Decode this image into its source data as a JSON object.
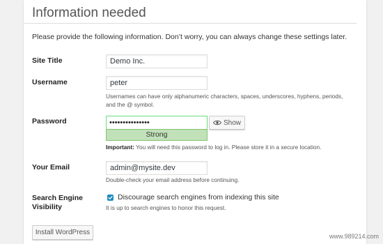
{
  "section": {
    "title": "Information needed",
    "intro": "Please provide the following information. Don’t worry, you can always change these settings later."
  },
  "site_title": {
    "label": "Site Title",
    "value": "Demo Inc."
  },
  "username": {
    "label": "Username",
    "value": "peter",
    "help": "Usernames can have only alphanumeric characters, spaces, underscores, hyphens, periods, and the @ symbol."
  },
  "password": {
    "label": "Password",
    "value": "•••••••••••••••",
    "strength": "Strong",
    "show_label": "Show",
    "note_strong": "Important:",
    "note_rest": " You will need this password to log in. Please store it in a secure location."
  },
  "email": {
    "label": "Your Email",
    "value": "admin@mysite.dev",
    "help": "Double-check your email address before continuing."
  },
  "search_engine": {
    "label_line1": "Search Engine",
    "label_line2": "Visibility",
    "checkbox_label": "Discourage search engines from indexing this site",
    "checked": true,
    "help": "It is up to search engines to honor this request."
  },
  "install_button": "Install WordPress",
  "watermark": "www.989214.com",
  "colors": {
    "checkbox": "#1e8cbe",
    "strength_bg": "#c1e1b9",
    "strength_border": "#83c373"
  }
}
